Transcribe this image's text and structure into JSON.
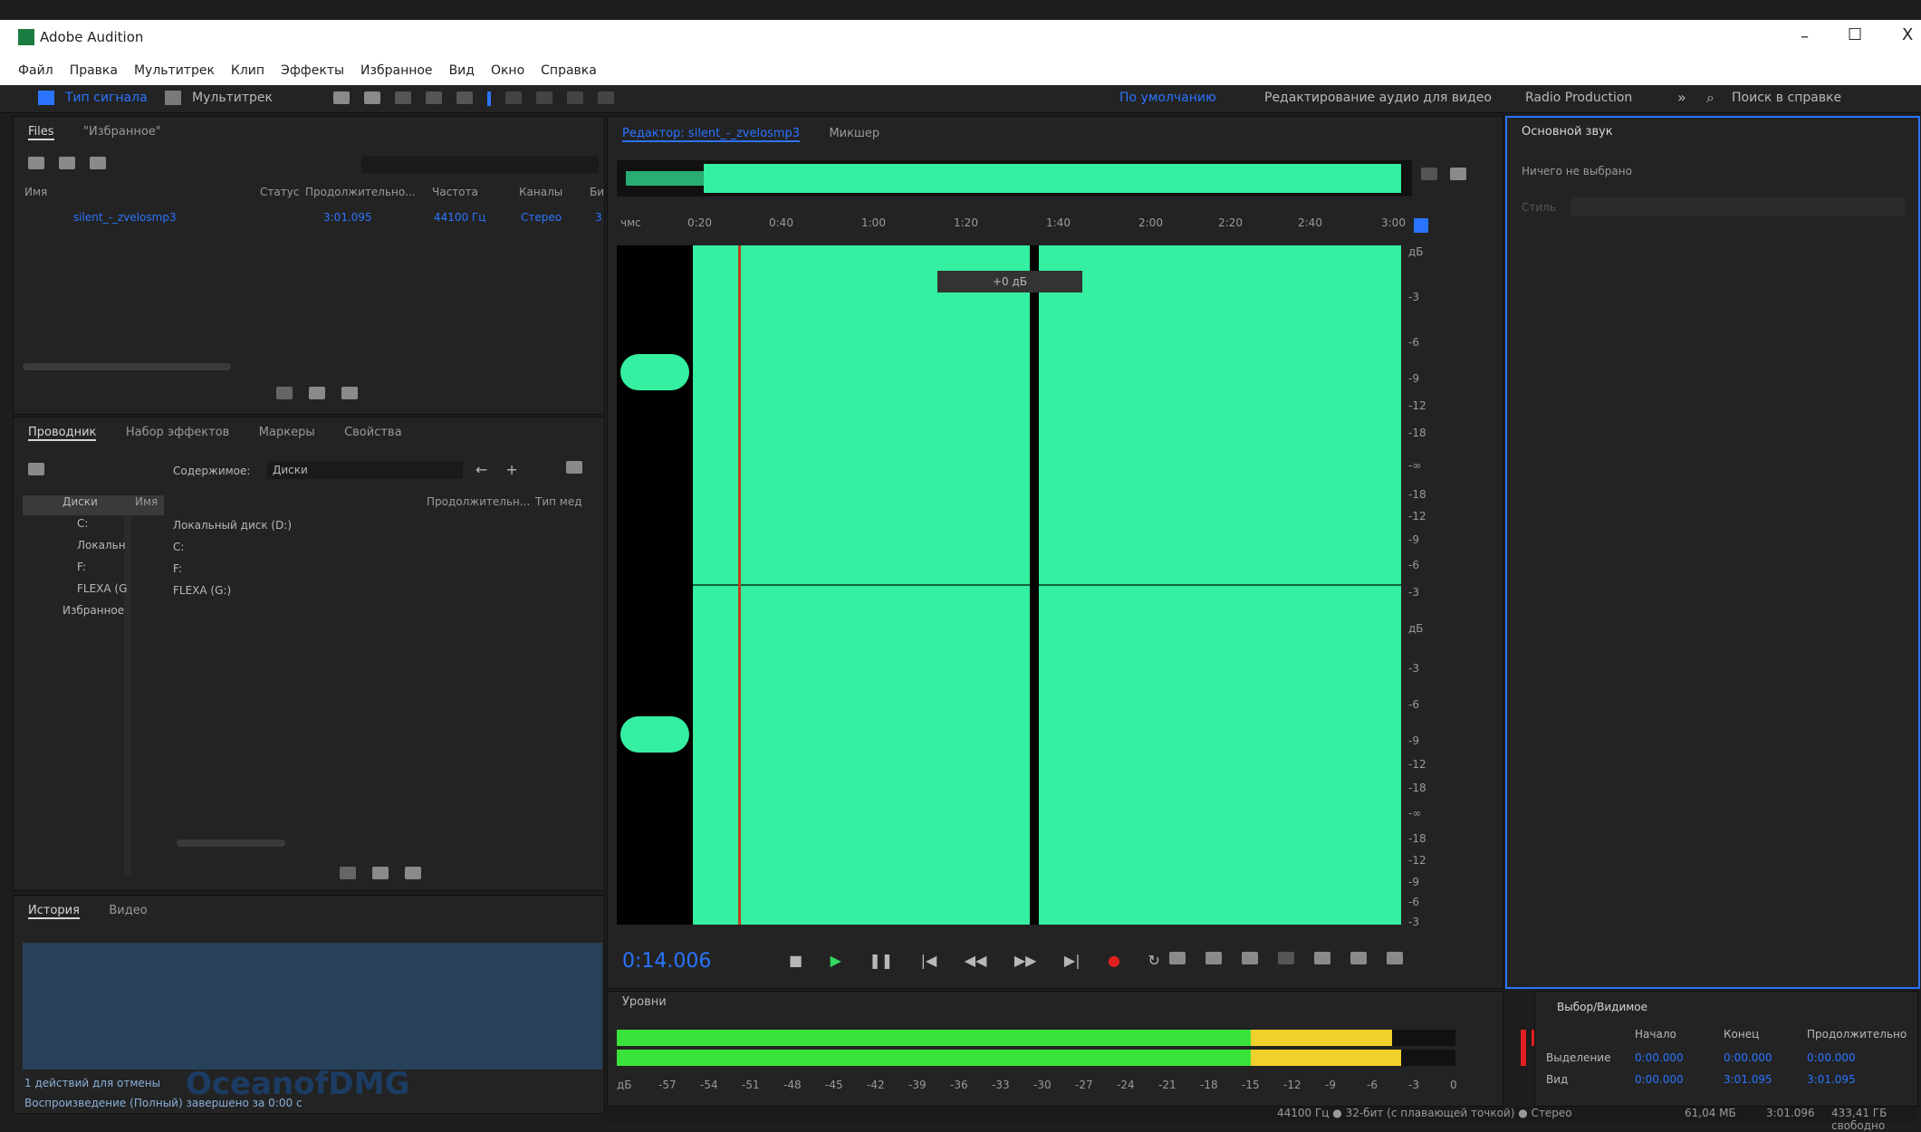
{
  "window": {
    "title": "Adobe Audition",
    "controls": {
      "min": "–",
      "max": "☐",
      "close": "X"
    }
  },
  "menu": [
    "Файл",
    "Правка",
    "Мультитрек",
    "Клип",
    "Эффекты",
    "Избранное",
    "Вид",
    "Окно",
    "Справка"
  ],
  "toolbar": {
    "left_modes": [
      "Тип сигнала",
      "Мультитрек"
    ],
    "workspaces": [
      "По умолчанию",
      "Редактирование аудио для видео",
      "Radio Production"
    ],
    "search_placeholder": "Поиск в справке"
  },
  "files_panel": {
    "tabs": [
      "Files",
      "\"Избранное\""
    ],
    "columns": [
      "Имя",
      "Статус",
      "Продолжительно...",
      "Частота",
      "Каналы",
      "Би"
    ],
    "rows": [
      {
        "name": "silent_-_zvelosmp3",
        "duration": "3:01.095",
        "rate": "44100 Гц",
        "channels": "Стерео",
        "bits": "3"
      }
    ]
  },
  "browser_panel": {
    "tabs": [
      "Проводник",
      "Набор эффектов",
      "Маркеры",
      "Свойства"
    ],
    "filter_label": "Содержимое:",
    "filter_value": "Диски",
    "tree": [
      "Диски",
      "C:",
      "Локальн",
      "F:",
      "FLEXA (G",
      "Избранное"
    ],
    "list_columns": [
      "Имя",
      "Продолжительн...",
      "Тип мед"
    ],
    "list": [
      "Локальный диск (D:)",
      "C:",
      "F:",
      "FLEXA (G:)"
    ]
  },
  "history_panel": {
    "tabs": [
      "История",
      "Видео"
    ],
    "status": "1 действий для отмены",
    "footer": "Воспроизведение (Полный) завершено за 0:00 с"
  },
  "editor": {
    "tabs": [
      "Редактор: silent_-_zvelosmp3",
      "Микшер"
    ],
    "ruler": [
      "чмс",
      "0:20",
      "0:40",
      "1:00",
      "1:20",
      "1:40",
      "2:00",
      "2:20",
      "2:40",
      "3:00"
    ],
    "hud_value": "+0 дБ",
    "db_scale_top": [
      "дБ",
      "-3",
      "-6",
      "-9",
      "-12",
      "-18",
      "-∞",
      "-18",
      "-12",
      "-9",
      "-6",
      "-3"
    ],
    "db_scale_bottom": [
      "дБ",
      "-3",
      "-6",
      "-9",
      "-12",
      "-18",
      "-∞",
      "-18",
      "-12",
      "-9",
      "-6",
      "-3"
    ],
    "time": "0:14.006"
  },
  "basic_sound": {
    "title": "Основной звук",
    "status": "Ничего не выбрано",
    "preset_label": "Стиль"
  },
  "levels_panel": {
    "title": "Уровни",
    "scale": [
      "дБ",
      "-57",
      "-54",
      "-51",
      "-48",
      "-45",
      "-42",
      "-39",
      "-36",
      "-33",
      "-30",
      "-27",
      "-24",
      "-21",
      "-18",
      "-15",
      "-12",
      "-9",
      "-6",
      "-3",
      "0"
    ]
  },
  "selection_panel": {
    "title": "Выбор/Видимое",
    "columns": [
      "Начало",
      "Конец",
      "Продолжительно"
    ],
    "rows": [
      {
        "label": "Выделение",
        "start": "0:00.000",
        "end": "0:00.000",
        "duration": "0:00.000"
      },
      {
        "label": "Вид",
        "start": "0:00.000",
        "end": "3:01.095",
        "duration": "3:01.095"
      }
    ]
  },
  "status_bar": {
    "text": "44100 Гц ● 32-бит (с плавающей точкой) ● Стерео",
    "size": "61,04 МБ",
    "time": "3:01.096",
    "disk": "433,41 ГБ свободно"
  },
  "watermark": "OceanofDMG",
  "colors": {
    "waveform": "#35f0a0",
    "accent": "#2a74ff",
    "meter_green": "#3ce23c",
    "meter_yellow": "#f1d12b"
  }
}
